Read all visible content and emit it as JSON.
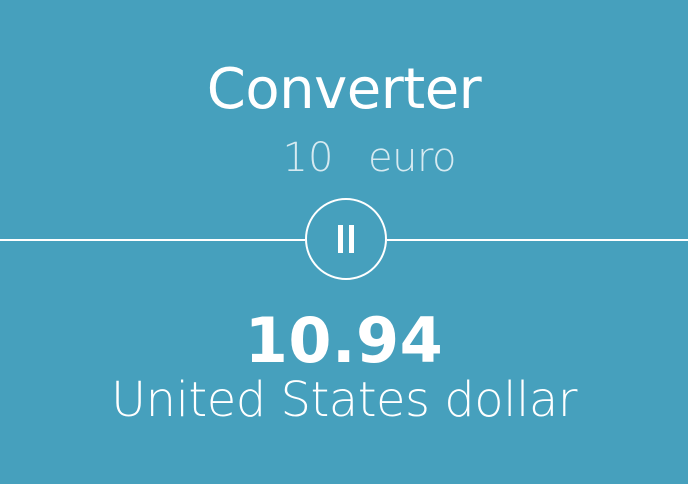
{
  "header": {
    "title": "Converter"
  },
  "input": {
    "amount": "10",
    "from_currency": "euro"
  },
  "swap": {
    "icon": "pause-icon"
  },
  "result": {
    "value": "10.94",
    "to_currency": "United States dollar"
  },
  "colors": {
    "background": "#46a0bd",
    "foreground": "#ffffff"
  }
}
